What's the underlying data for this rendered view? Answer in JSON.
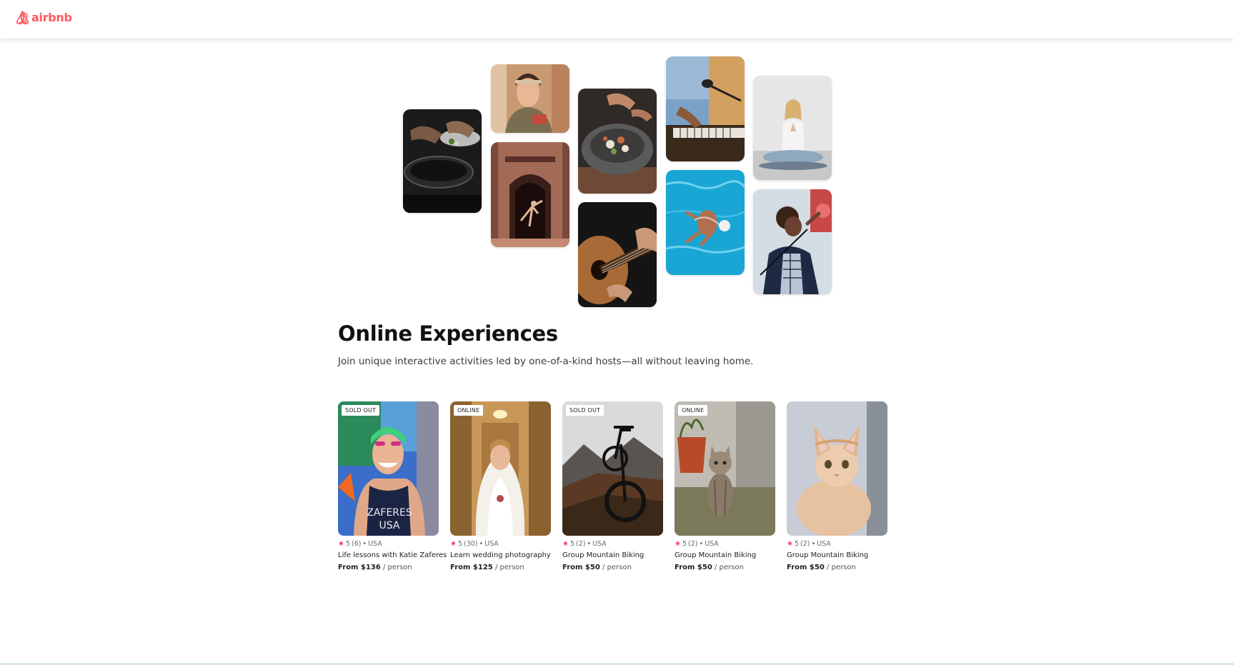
{
  "brand": {
    "name": "airbnb",
    "color": "#FF5A5F",
    "icon": "airbnb-logo-icon"
  },
  "hero": {
    "photos": [
      {
        "name": "cooking-photo",
        "depicts": "hands cooking with pans"
      },
      {
        "name": "woman-portrait-photo",
        "depicts": "woman with headband"
      },
      {
        "name": "dancer-doorway-photo",
        "depicts": "dancer in ornate doorway"
      },
      {
        "name": "food-bowl-photo",
        "depicts": "garnishing a bowl of food"
      },
      {
        "name": "guitar-photo",
        "depicts": "playing acoustic guitar"
      },
      {
        "name": "keyboard-microphone-photo",
        "depicts": "musician at keyboard and microphone"
      },
      {
        "name": "swimmer-photo",
        "depicts": "swimmer in pool"
      },
      {
        "name": "meditation-photo",
        "depicts": "woman meditating"
      },
      {
        "name": "singer-photo",
        "depicts": "man singing into microphone"
      }
    ]
  },
  "section": {
    "title": "Online Experiences",
    "subtitle": "Join unique interactive activities led by one-of-a-kind hosts—all without leaving home."
  },
  "cards": [
    {
      "badge": "SOLD OUT",
      "rating": "5",
      "reviews": "(6)",
      "location": "USA",
      "title": "Life lessons with Katie Zaferes",
      "price_prefix": "From",
      "price": "$136",
      "price_suffix": "/ person",
      "image": "athlete-photo"
    },
    {
      "badge": "ONLINE",
      "rating": "5",
      "reviews": "(30)",
      "location": "USA",
      "title": "Learn wedding photography",
      "price_prefix": "From",
      "price": "$125",
      "price_suffix": "/ person",
      "image": "bride-photo"
    },
    {
      "badge": "SOLD OUT",
      "rating": "5",
      "reviews": "(2)",
      "location": "USA",
      "title": "Group Mountain Biking",
      "price_prefix": "From",
      "price": "$50",
      "price_suffix": "/ person",
      "image": "mountain-bike-photo"
    },
    {
      "badge": "ONLINE",
      "rating": "5",
      "reviews": "(2)",
      "location": "USA",
      "title": "Group Mountain Biking",
      "price_prefix": "From",
      "price": "$50",
      "price_suffix": "/ person",
      "image": "kitten-pot-photo"
    },
    {
      "badge": "",
      "rating": "5",
      "reviews": "(2)",
      "location": "USA",
      "title": "Group Mountain Biking",
      "price_prefix": "From",
      "price": "$50",
      "price_suffix": "/ person",
      "image": "kitten-photo"
    }
  ],
  "colors": {
    "accent": "#FE385C",
    "text": "#222222"
  }
}
